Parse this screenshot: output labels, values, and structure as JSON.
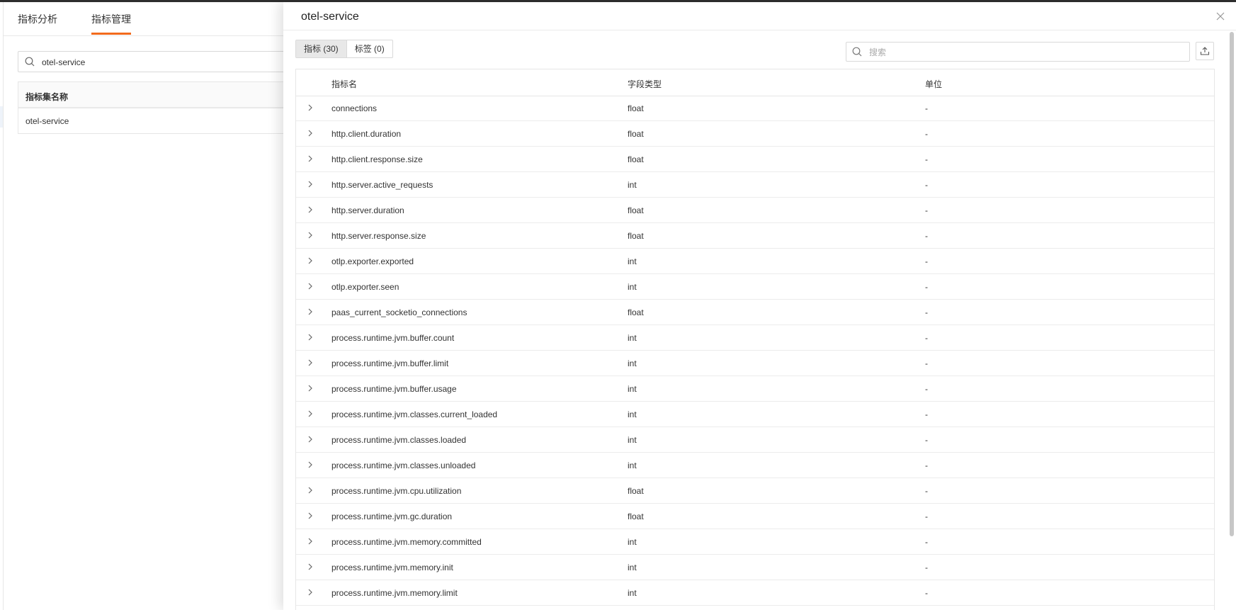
{
  "left_page": {
    "tabs": [
      {
        "label": "指标分析",
        "active": false
      },
      {
        "label": "指标管理",
        "active": true
      }
    ],
    "search": {
      "value": "otel-service"
    },
    "table": {
      "header": "指标集名称",
      "rows": [
        "otel-service"
      ]
    }
  },
  "drawer": {
    "title": "otel-service",
    "segments": [
      {
        "label": "指标 (30)",
        "active": true
      },
      {
        "label": "标签 (0)",
        "active": false
      }
    ],
    "search": {
      "placeholder": "搜索"
    },
    "columns": [
      "指标名",
      "字段类型",
      "单位"
    ],
    "rows": [
      {
        "name": "connections",
        "type": "float",
        "unit": "-"
      },
      {
        "name": "http.client.duration",
        "type": "float",
        "unit": "-"
      },
      {
        "name": "http.client.response.size",
        "type": "float",
        "unit": "-"
      },
      {
        "name": "http.server.active_requests",
        "type": "int",
        "unit": "-"
      },
      {
        "name": "http.server.duration",
        "type": "float",
        "unit": "-"
      },
      {
        "name": "http.server.response.size",
        "type": "float",
        "unit": "-"
      },
      {
        "name": "otlp.exporter.exported",
        "type": "int",
        "unit": "-"
      },
      {
        "name": "otlp.exporter.seen",
        "type": "int",
        "unit": "-"
      },
      {
        "name": "paas_current_socketio_connections",
        "type": "float",
        "unit": "-"
      },
      {
        "name": "process.runtime.jvm.buffer.count",
        "type": "int",
        "unit": "-"
      },
      {
        "name": "process.runtime.jvm.buffer.limit",
        "type": "int",
        "unit": "-"
      },
      {
        "name": "process.runtime.jvm.buffer.usage",
        "type": "int",
        "unit": "-"
      },
      {
        "name": "process.runtime.jvm.classes.current_loaded",
        "type": "int",
        "unit": "-"
      },
      {
        "name": "process.runtime.jvm.classes.loaded",
        "type": "int",
        "unit": "-"
      },
      {
        "name": "process.runtime.jvm.classes.unloaded",
        "type": "int",
        "unit": "-"
      },
      {
        "name": "process.runtime.jvm.cpu.utilization",
        "type": "float",
        "unit": "-"
      },
      {
        "name": "process.runtime.jvm.gc.duration",
        "type": "float",
        "unit": "-"
      },
      {
        "name": "process.runtime.jvm.memory.committed",
        "type": "int",
        "unit": "-"
      },
      {
        "name": "process.runtime.jvm.memory.init",
        "type": "int",
        "unit": "-"
      },
      {
        "name": "process.runtime.jvm.memory.limit",
        "type": "int",
        "unit": "-"
      }
    ]
  },
  "colors": {
    "accent": "#f26b1d",
    "border": "#e6e6e6",
    "text": "#333333",
    "active_segment_bg": "#e8e8e8"
  },
  "icons": {
    "search": "search-icon",
    "close": "close-icon",
    "export": "upload-icon",
    "expand": "chevron-right-icon"
  }
}
